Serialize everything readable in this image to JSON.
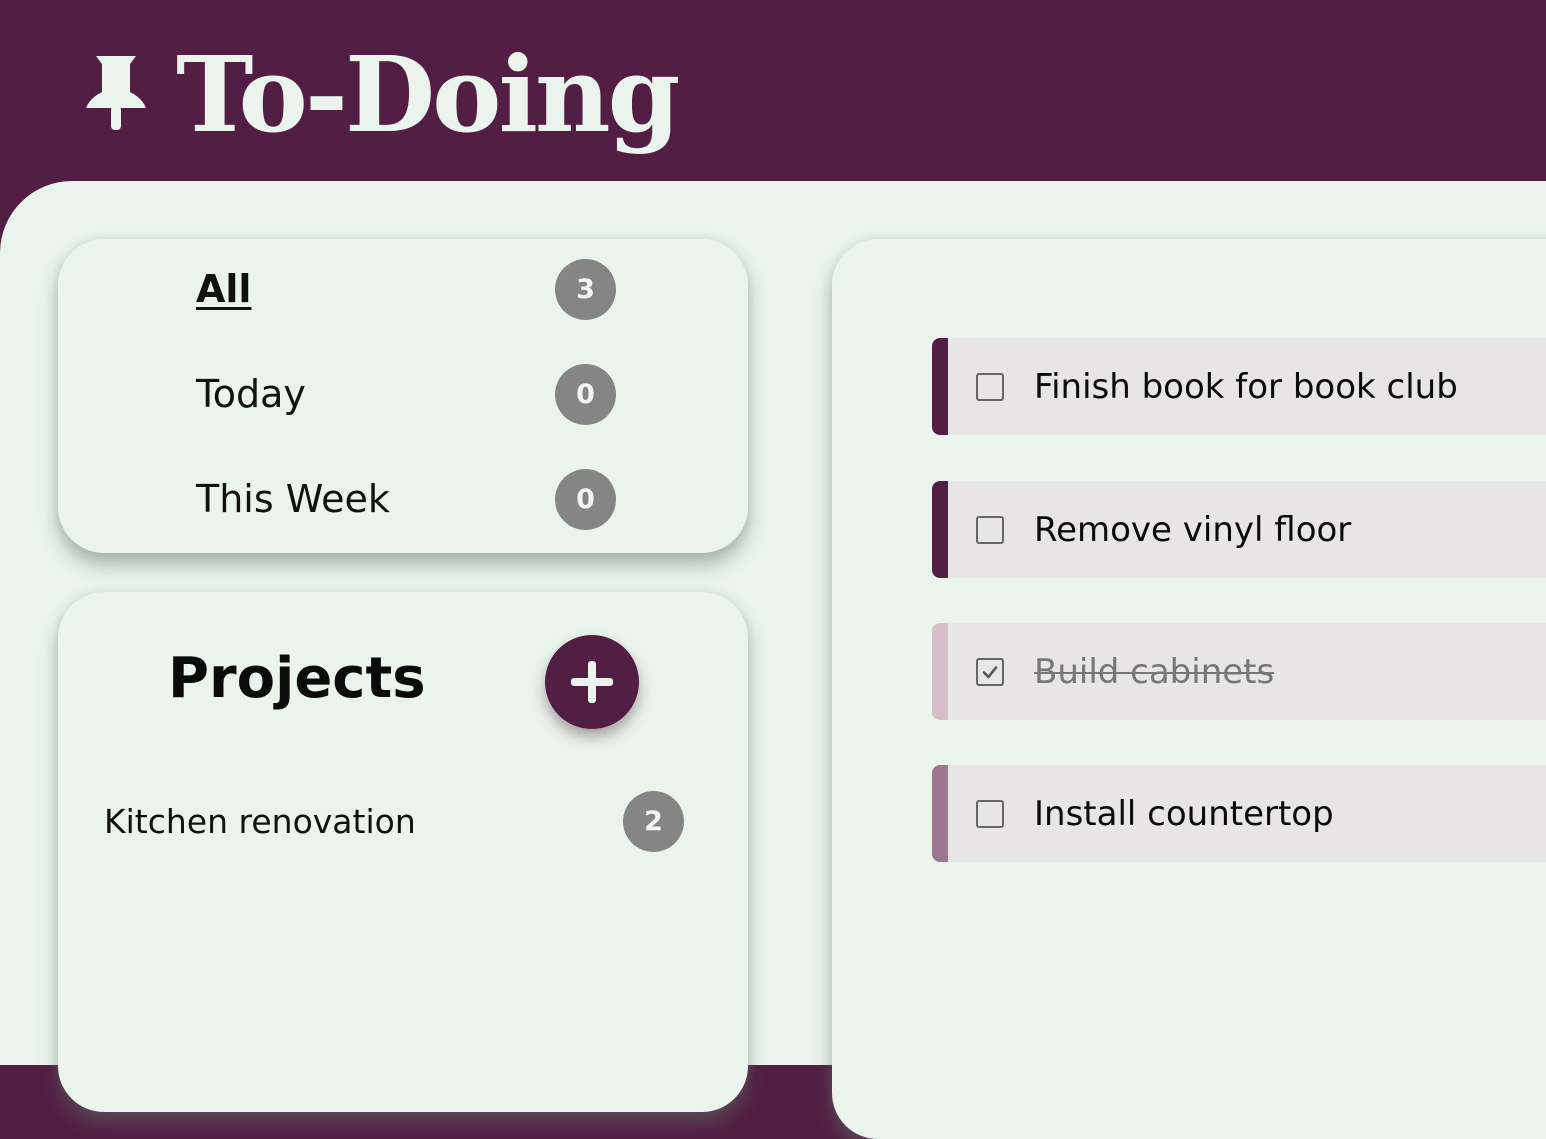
{
  "header": {
    "title": "To-Doing",
    "icon": "pushpin-icon"
  },
  "filters": [
    {
      "label": "All",
      "count": "3",
      "active": true
    },
    {
      "label": "Today",
      "count": "0",
      "active": false
    },
    {
      "label": "This Week",
      "count": "0",
      "active": false
    }
  ],
  "projects": {
    "title": "Projects",
    "add_icon": "plus-icon",
    "items": [
      {
        "name": "Kitchen renovation",
        "count": "2"
      }
    ]
  },
  "tasks": [
    {
      "text": "Finish book for book club",
      "done": false,
      "priority_color": "#531e43"
    },
    {
      "text": "Remove vinyl floor",
      "done": false,
      "priority_color": "#531e43"
    },
    {
      "text": "Build cabinets",
      "done": true,
      "priority_color": "#d5bfca"
    },
    {
      "text": "Install countertop",
      "done": false,
      "priority_color": "#9c7790"
    }
  ],
  "colors": {
    "brand": "#531e43",
    "background": "#eaf4ec",
    "badge": "#858585",
    "task_bg": "#e7e5e6"
  }
}
